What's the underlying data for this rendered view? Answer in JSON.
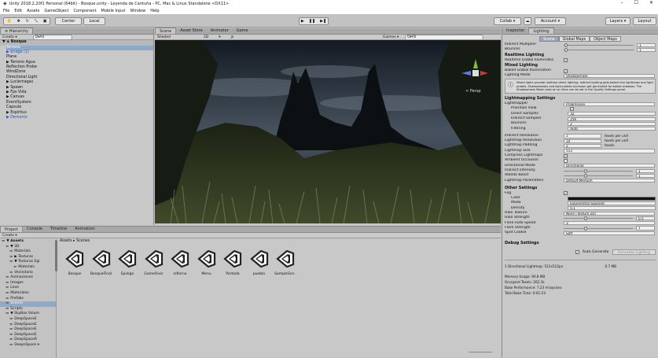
{
  "window": {
    "title": "Unity 2018.2.20f1 Personal (64bit) - Bosque.unity - Leyenda de Cantuña - PC, Mac & Linux Standalone <DX11>",
    "min": "–",
    "max": "☐",
    "close": "✕"
  },
  "menu": [
    "File",
    "Edit",
    "Assets",
    "GameObject",
    "Component",
    "Mobile Input",
    "Window",
    "Help"
  ],
  "toolbar": {
    "center": "Center",
    "local": "Local",
    "play": "▶",
    "pause": "❚❚",
    "step": "▶❚",
    "collab": "Collab ▾",
    "account": "Account ▾",
    "layers": "Layers ▾",
    "layout": "Layout"
  },
  "hierarchy": {
    "tab": "Hierarchy",
    "create": "Create ▾",
    "search": "Q▾All",
    "scene": "Bosque",
    "items": [
      {
        "label": "Terreno",
        "sel": true,
        "blue": false
      },
      {
        "label": "▶ bridge (1)",
        "sel": false,
        "blue": true
      },
      {
        "label": "Plane",
        "sel": false,
        "blue": false
      },
      {
        "label": "▶ Terreno Agua",
        "sel": false,
        "blue": false
      },
      {
        "label": "Reflection Probe",
        "sel": false,
        "blue": false
      },
      {
        "label": "WindZone",
        "sel": false,
        "blue": false
      },
      {
        "label": "Directional Light",
        "sel": false,
        "blue": false
      },
      {
        "label": "▶ Luciernagas",
        "sel": false,
        "blue": false
      },
      {
        "label": "▶ Spawn",
        "sel": false,
        "blue": false
      },
      {
        "label": "▶ Fps Vida",
        "sel": false,
        "blue": false
      },
      {
        "label": "▶ Canvas",
        "sel": false,
        "blue": false
      },
      {
        "label": "EventSystem",
        "sel": false,
        "blue": false
      },
      {
        "label": "Capsule",
        "sel": false,
        "blue": false
      },
      {
        "label": "▶ Espiritus",
        "sel": false,
        "blue": false
      },
      {
        "label": "▶ Demonio",
        "sel": false,
        "blue": true
      }
    ]
  },
  "scene_view": {
    "tabs": [
      "Scene",
      "Asset Store",
      "Animator",
      "Game"
    ],
    "shaded": "Shaded",
    "mode2d": "2D",
    "gizmos": "Gizmos ▾",
    "search": "Q▾All",
    "persp": "< Persp"
  },
  "inspector": {
    "tabs": [
      "Inspector",
      "Lighting"
    ],
    "subtabs": [
      "Scene",
      "Global Maps",
      "Object Maps"
    ],
    "top_rows": [
      {
        "label": "Indirect Multiplier",
        "value": "1"
      },
      {
        "label": "Bounces",
        "value": "1"
      }
    ],
    "realtime": {
      "title": "Realtime Lighting",
      "row": "Realtime Global Illuminatio"
    },
    "mixed": {
      "title": "Mixed Lighting",
      "baked": "Baked Global Illumination",
      "mode_label": "Lighting Mode",
      "mode_value": "Shadowmask",
      "info": "Mixed lights provide realtime direct lighting. Indirect lighting gets baked into lightmaps and light probes. Shadowmasks and light probes occlusion get generated for baked shadows. The Shadowmask Mode used at run time can be set in the Quality Settings panel."
    },
    "lightmapping": {
      "title": "Lightmapping Settings",
      "rows": [
        {
          "label": "Lightmapper",
          "value": "Progressive",
          "kind": "dropdown"
        },
        {
          "label": "Prioritize View",
          "value": "✓",
          "kind": "check"
        },
        {
          "label": "Direct Samples",
          "value": "32",
          "kind": "field"
        },
        {
          "label": "Indirect Samples",
          "value": "256",
          "kind": "field"
        },
        {
          "label": "Bounces",
          "value": "2",
          "kind": "dropdown"
        },
        {
          "label": "Filtering",
          "value": "Auto",
          "kind": "dropdown"
        },
        {
          "label": "Indirect Resolution",
          "value": "2",
          "kind": "unit",
          "unit": "texels per unit"
        },
        {
          "label": "Lightmap Resolution",
          "value": "10",
          "kind": "unit",
          "unit": "texels per unit"
        },
        {
          "label": "Lightmap Padding",
          "value": "2",
          "kind": "unit",
          "unit": "texels"
        },
        {
          "label": "Lightmap Size",
          "value": "512",
          "kind": "dropdown"
        },
        {
          "label": "Compress Lightmaps",
          "value": "✓",
          "kind": "check"
        },
        {
          "label": "Ambient Occlusion",
          "value": "",
          "kind": "check"
        },
        {
          "label": "Directional Mode",
          "value": "Directional",
          "kind": "dropdown"
        },
        {
          "label": "Indirect Intensity",
          "value": "1",
          "kind": "slider"
        },
        {
          "label": "Albedo Boost",
          "value": "1",
          "kind": "slider"
        },
        {
          "label": "Lightmap Parameters",
          "value": "Default-Medium",
          "kind": "dropdown"
        }
      ]
    },
    "other": {
      "title": "Other Settings",
      "rows": [
        {
          "label": "Fog",
          "value": "✓",
          "kind": "check"
        },
        {
          "label": "Color",
          "value": "",
          "kind": "color"
        },
        {
          "label": "Mode",
          "value": "Exponential Squared",
          "kind": "dropdown"
        },
        {
          "label": "Density",
          "value": "0.1",
          "kind": "field"
        },
        {
          "label": "Halo Texture",
          "value": "None (Texture 2D)",
          "kind": "dropdown"
        },
        {
          "label": "Halo Strength",
          "value": "0.5",
          "kind": "slider"
        },
        {
          "label": "Flare Fade Speed",
          "value": "3",
          "kind": "field"
        },
        {
          "label": "Flare Strength",
          "value": "1",
          "kind": "slider"
        },
        {
          "label": "Spot Cookie",
          "value": "Soft",
          "kind": "dropdown"
        }
      ]
    },
    "debug": {
      "title": "Debug Settings"
    },
    "auto_generate": "Auto Generate",
    "generate_btn": "Generate Lighting",
    "stats": {
      "lightmaps": "1 Directional Lightmap: 512x512px",
      "size": "0.7 MB",
      "memory": "Memory Usage: 90.8 MB",
      "texels": "Occupied Texels: 262.1k",
      "bake_perf": "Bake Performance: 7.23 mrays/sec",
      "bake_time": "Total Bake Time: 0:01:23"
    }
  },
  "project": {
    "tabs": [
      "Project",
      "Console",
      "Timeline",
      "Animation"
    ],
    "create": "Create ▾",
    "breadcrumb": "Assets ▸ Scenes",
    "tree": [
      {
        "label": "▼ Assets",
        "indent": 0,
        "bold": true,
        "sel": false
      },
      {
        "label": "▼ 3D",
        "indent": 1,
        "bold": false,
        "sel": false
      },
      {
        "label": "Materials",
        "indent": 2,
        "bold": false,
        "sel": false
      },
      {
        "label": "▶ Texturas",
        "indent": 2,
        "bold": false,
        "sel": false
      },
      {
        "label": "▼ Texturas Egi",
        "indent": 2,
        "bold": false,
        "sel": false
      },
      {
        "label": "Materials",
        "indent": 3,
        "bold": false,
        "sel": false
      },
      {
        "label": "Vecindario",
        "indent": 2,
        "bold": false,
        "sel": false
      },
      {
        "label": "Animaciones",
        "indent": 1,
        "bold": false,
        "sel": false
      },
      {
        "label": "Images",
        "indent": 1,
        "bold": false,
        "sel": false
      },
      {
        "label": "Leve",
        "indent": 1,
        "bold": false,
        "sel": false
      },
      {
        "label": "Materiales",
        "indent": 1,
        "bold": false,
        "sel": false
      },
      {
        "label": "Prefabs",
        "indent": 1,
        "bold": false,
        "sel": false
      },
      {
        "label": "Scenes",
        "indent": 1,
        "bold": false,
        "sel": true
      },
      {
        "label": "Scripts",
        "indent": 1,
        "bold": false,
        "sel": false
      },
      {
        "label": "▼ SkyBox Volum",
        "indent": 1,
        "bold": false,
        "sel": false
      },
      {
        "label": "DeepSpaceE",
        "indent": 2,
        "bold": false,
        "sel": false
      },
      {
        "label": "DeepSpaceE",
        "indent": 2,
        "bold": false,
        "sel": false
      },
      {
        "label": "DeepSpaceE",
        "indent": 2,
        "bold": false,
        "sel": false
      },
      {
        "label": "DeepSpaceE",
        "indent": 2,
        "bold": false,
        "sel": false
      },
      {
        "label": "DeepSpaceR",
        "indent": 2,
        "bold": false,
        "sel": false
      },
      {
        "label": "DeepsSpace ▾",
        "indent": 2,
        "bold": false,
        "sel": false
      }
    ],
    "assets": [
      "Bosque",
      "BosqueFinal",
      "Epilogo",
      "GameOver",
      "infierno",
      "Menu",
      "Portada",
      "pueblo",
      "SampleSce.."
    ]
  }
}
